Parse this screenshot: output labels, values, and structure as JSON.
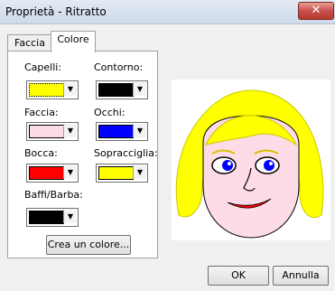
{
  "window": {
    "title": "Proprietà - Ritratto",
    "close_label": "✕"
  },
  "tabs": [
    {
      "label": "Faccia"
    },
    {
      "label": "Colore"
    }
  ],
  "colors": [
    {
      "label": "Capelli:",
      "value": "#ffff00"
    },
    {
      "label": "Contorno:",
      "value": "#000000"
    },
    {
      "label": "Faccia:",
      "value": "#fddce8"
    },
    {
      "label": "Occhi:",
      "value": "#0000ff"
    },
    {
      "label": "Bocca:",
      "value": "#ff0000"
    },
    {
      "label": "Sopracciglia:",
      "value": "#ffff00"
    },
    {
      "label": "Baffi/Barba:",
      "value": "#000000"
    }
  ],
  "buttons": {
    "create_color": "Crea un colore...",
    "ok": "OK",
    "cancel": "Annulla"
  },
  "icons": {
    "dropdown": "▼"
  }
}
